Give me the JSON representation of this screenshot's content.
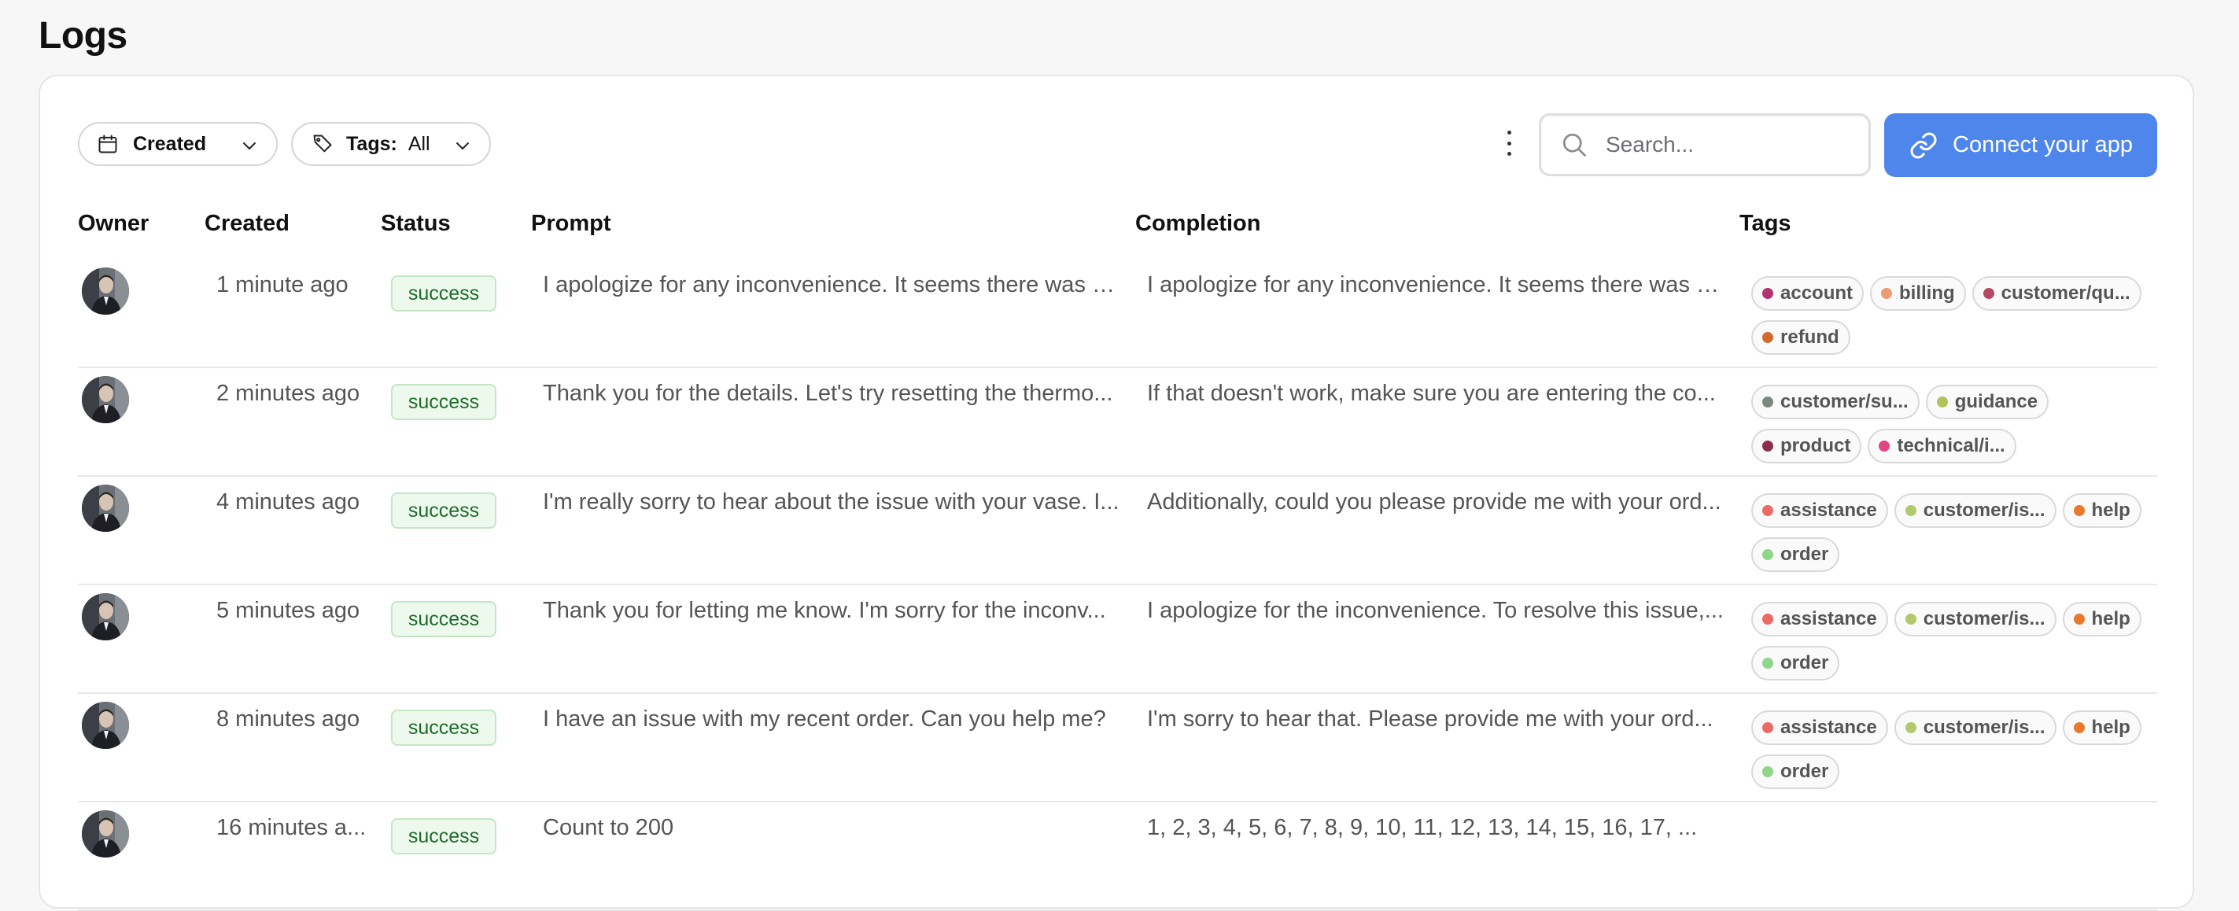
{
  "page": {
    "title": "Logs"
  },
  "filters": {
    "created_label": "Created",
    "tags_label": "Tags:",
    "tags_value": "All"
  },
  "search": {
    "placeholder": "Search..."
  },
  "connect_button": {
    "label": "Connect your app",
    "color": "#4f86ec"
  },
  "columns": {
    "owner": "Owner",
    "created": "Created",
    "status": "Status",
    "prompt": "Prompt",
    "completion": "Completion",
    "tags": "Tags"
  },
  "rows": [
    {
      "created": "1 minute ago",
      "status": "success",
      "prompt": "I apologize for any inconvenience. It seems there was a...",
      "completion": "I apologize for any inconvenience. It seems there was a...",
      "tags": [
        {
          "label": "account",
          "color": "#b5316f"
        },
        {
          "label": "billing",
          "color": "#ee9b73"
        },
        {
          "label": "customer/qu...",
          "color": "#b24a63"
        },
        {
          "label": "refund",
          "color": "#d2692d"
        }
      ]
    },
    {
      "created": "2 minutes ago",
      "status": "success",
      "prompt": "Thank you for the details. Let's try resetting the thermo...",
      "completion": "If that doesn't work, make sure you are entering the co...",
      "tags": [
        {
          "label": "customer/su...",
          "color": "#7a8a80"
        },
        {
          "label": "guidance",
          "color": "#b3c35c"
        },
        {
          "label": "product",
          "color": "#8d2e4c"
        },
        {
          "label": "technical/i...",
          "color": "#e24681"
        }
      ]
    },
    {
      "created": "4 minutes ago",
      "status": "success",
      "prompt": "I'm really sorry to hear about the issue with your vase. I...",
      "completion": "Additionally, could you please provide me with your ord...",
      "tags": [
        {
          "label": "assistance",
          "color": "#ec6a64"
        },
        {
          "label": "customer/is...",
          "color": "#b3c96b"
        },
        {
          "label": "help",
          "color": "#e8792d"
        },
        {
          "label": "order",
          "color": "#8fd68a"
        }
      ]
    },
    {
      "created": "5 minutes ago",
      "status": "success",
      "prompt": "Thank you for letting me know. I'm sorry for the inconv...",
      "completion": "I apologize for the inconvenience. To resolve this issue,...",
      "tags": [
        {
          "label": "assistance",
          "color": "#ec6a64"
        },
        {
          "label": "customer/is...",
          "color": "#b3c96b"
        },
        {
          "label": "help",
          "color": "#e8792d"
        },
        {
          "label": "order",
          "color": "#8fd68a"
        }
      ]
    },
    {
      "created": "8 minutes ago",
      "status": "success",
      "prompt": "I have an issue with my recent order. Can you help me?",
      "completion": "I'm sorry to hear that. Please provide me with your ord...",
      "tags": [
        {
          "label": "assistance",
          "color": "#ec6a64"
        },
        {
          "label": "customer/is...",
          "color": "#b3c96b"
        },
        {
          "label": "help",
          "color": "#e8792d"
        },
        {
          "label": "order",
          "color": "#8fd68a"
        }
      ]
    },
    {
      "created": "16 minutes a...",
      "status": "success",
      "prompt": "Count to 200",
      "completion": "1, 2, 3, 4, 5, 6, 7, 8, 9, 10, 11, 12, 13, 14, 15, 16, 17, ...",
      "tags": []
    }
  ]
}
